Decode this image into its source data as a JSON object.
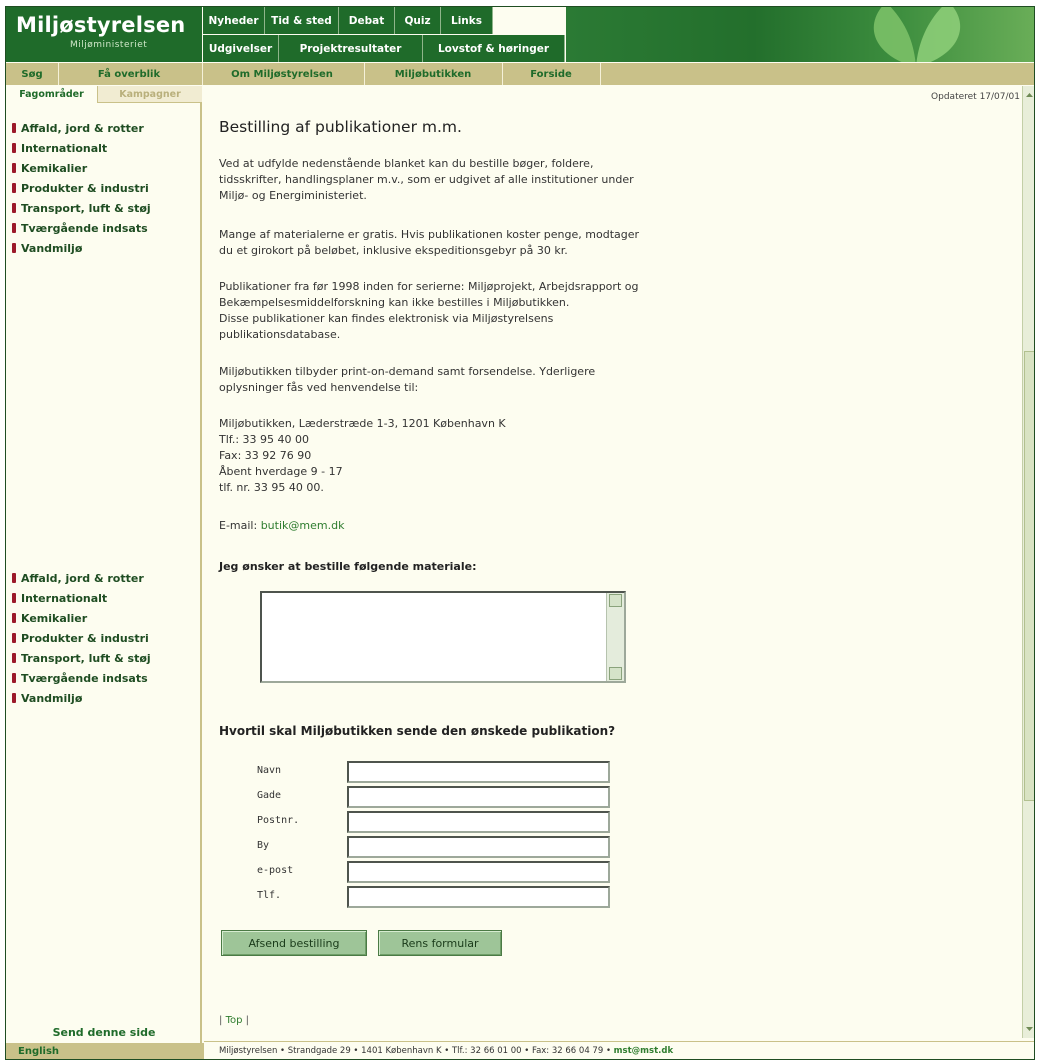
{
  "header": {
    "logo_title": "Miljøstyrelsen",
    "logo_subtitle": "Miljøministeriet",
    "nav_top": [
      "Nyheder",
      "Tid & sted",
      "Debat",
      "Quiz",
      "Links"
    ],
    "nav_mid": [
      "Udgivelser",
      "Projektresultater",
      "Lovstof & høringer"
    ],
    "bar3_left": [
      "Søg",
      "Få overblik"
    ],
    "bar3_right": [
      "Om Miljøstyrelsen",
      "Miljøbutikken",
      "Forside"
    ]
  },
  "sidebar": {
    "tabs": [
      "Fagområder",
      "Kampagner"
    ],
    "items": [
      "Affald, jord & rotter",
      "Internationalt",
      "Kemikalier",
      "Produkter & industri",
      "Transport, luft & støj",
      "Tværgående indsats",
      "Vandmiljø"
    ],
    "send_link": "Send denne side",
    "english_link": "English"
  },
  "main": {
    "updated": "Opdateret 17/07/01",
    "title": "Bestilling af publikationer m.m.",
    "para1": [
      "Ved at udfylde nedenstående blanket kan du bestille bøger, foldere,",
      "tidsskrifter, handlingsplaner m.v., som er udgivet af alle institutioner under",
      "Miljø- og Energiministeriet."
    ],
    "para2": [
      "Mange af materialerne er gratis. Hvis publikationen koster penge, modtager",
      "du et girokort på beløbet, inklusive ekspeditionsgebyr på 30 kr."
    ],
    "para3": [
      "Publikationer fra før 1998 inden for serierne: Miljøprojekt, Arbejdsrapport og",
      "Bekæmpelsesmiddelforskning kan ikke bestilles i Miljøbutikken.",
      "Disse publikationer kan findes elektronisk via Miljøstyrelsens",
      "publikationsdatabase."
    ],
    "para4": [
      "Miljøbutikken tilbyder print-on-demand samt forsendelse. Yderligere",
      "oplysninger fås ved henvendelse til:"
    ],
    "address": [
      "Miljøbutikken, Læderstræde 1-3, 1201 København K",
      "Tlf.:  33 95 40 00",
      "Fax:  33 92 76 90",
      "Åbent hverdage 9 - 17",
      "tlf. nr. 33 95 40 00."
    ],
    "email_label": "E-mail: ",
    "email": "butik@mem.dk",
    "order_heading": "Jeg ønsker at bestille følgende materiale:",
    "address_heading": "Hvortil skal Miljøbutikken sende den ønskede publikation?",
    "form_labels": [
      "Navn",
      "Gade",
      "Postnr.",
      "By",
      "e-post",
      "Tlf."
    ],
    "submit_label": "Afsend bestilling",
    "reset_label": "Rens formular",
    "top_prefix": "| ",
    "top_link": "Top",
    "top_suffix": " |"
  },
  "footer": {
    "text": "Miljøstyrelsen • Strandgade 29 • 1401 København K • Tlf.: 32 66 01 00 • Fax: 32 66 04 79 • ",
    "email": "mst@mst.dk"
  },
  "colors": {
    "brand_green": "#1f6b2a",
    "khaki_bar": "#c9c189",
    "bullet_red": "#9c1a2a",
    "link_green": "#2f7d2f",
    "button_green": "#9ec598"
  }
}
